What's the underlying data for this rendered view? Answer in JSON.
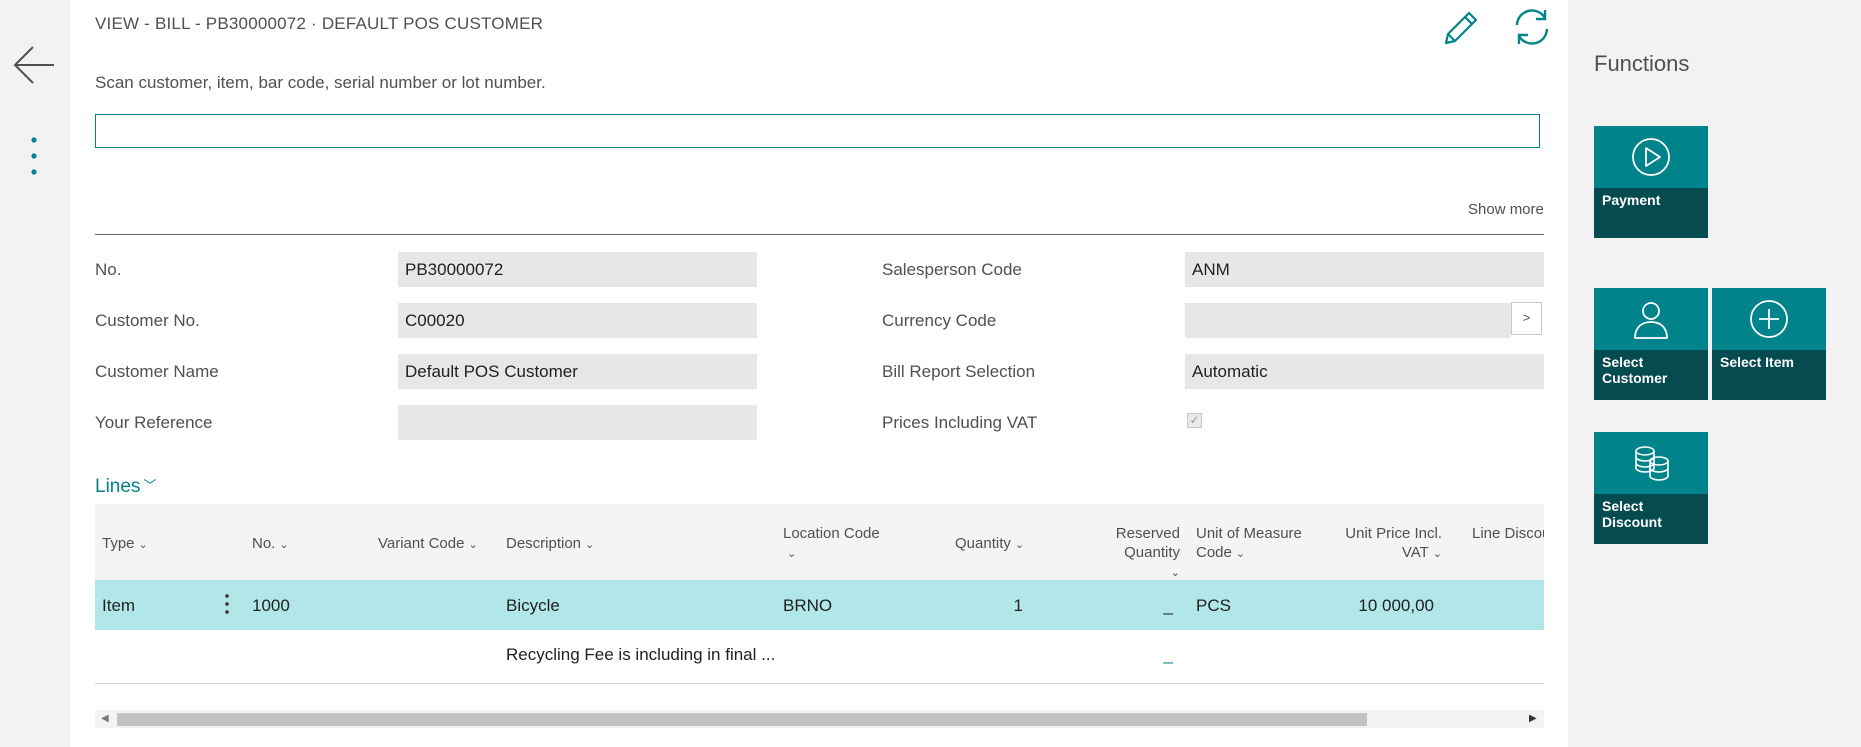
{
  "header": {
    "title": "VIEW - BILL - PB30000072 · DEFAULT POS CUSTOMER"
  },
  "scan": {
    "label": "Scan customer, item, bar code, serial number or lot number.",
    "value": "",
    "placeholder": ""
  },
  "show_more": "Show more",
  "fields": {
    "no": {
      "label": "No.",
      "value": "PB30000072"
    },
    "customer_no": {
      "label": "Customer No.",
      "value": "C00020"
    },
    "customer_name": {
      "label": "Customer Name",
      "value": "Default POS Customer"
    },
    "your_reference": {
      "label": "Your Reference",
      "value": ""
    },
    "salesperson_code": {
      "label": "Salesperson Code",
      "value": "ANM"
    },
    "currency_code": {
      "label": "Currency Code",
      "value": "",
      "lookup_label": ">"
    },
    "bill_report_selection": {
      "label": "Bill Report Selection",
      "value": "Automatic"
    },
    "prices_including_vat": {
      "label": "Prices Including VAT",
      "checked": true,
      "check_glyph": "✓"
    }
  },
  "lines": {
    "heading": "Lines",
    "chevron": "﹀",
    "columns": {
      "type": "Type",
      "no": "No.",
      "variant_code": "Variant Code",
      "description": "Description",
      "location_code": "Location Code",
      "quantity": "Quantity",
      "reserved_quantity": "Reserved Quantity",
      "unit_of_measure_code_1": "Unit of Measure",
      "unit_of_measure_code_2": "Code",
      "unit_price_incl_vat_1": "Unit Price Incl.",
      "unit_price_incl_vat_2": "VAT",
      "line_discount": "Line Discou"
    },
    "arrow": "⌄",
    "rows": [
      {
        "type": "Item",
        "no": "1000",
        "variant_code": "",
        "description": "Bicycle",
        "location_code": "BRNO",
        "quantity": "1",
        "reserved_quantity": "_",
        "unit_of_measure_code": "PCS",
        "unit_price_incl_vat": "10 000,00",
        "selected": true
      },
      {
        "type": "",
        "no": "",
        "variant_code": "",
        "description": "Recycling Fee is including in final ...",
        "location_code": "",
        "quantity": "",
        "reserved_quantity": "_",
        "unit_of_measure_code": "",
        "unit_price_incl_vat": "",
        "selected": false
      }
    ]
  },
  "scrollbar": {
    "left_arrow": "◀",
    "right_arrow": "▶"
  },
  "functions": {
    "title": "Functions",
    "tiles": {
      "payment": {
        "label": "Payment",
        "icon": "play-circle-icon"
      },
      "select_customer": {
        "label_1": "Select",
        "label_2": "Customer",
        "icon": "person-icon"
      },
      "select_item": {
        "label": "Select Item",
        "icon": "plus-circle-icon"
      },
      "select_discount": {
        "label_1": "Select",
        "label_2": "Discount",
        "icon": "coins-icon"
      }
    }
  },
  "colors": {
    "accent": "#00838a",
    "tile_top": "#00838a",
    "tile_bottom": "#054b4f",
    "selected_row": "#b2e7e9",
    "field_background": "#e6e7e8"
  }
}
